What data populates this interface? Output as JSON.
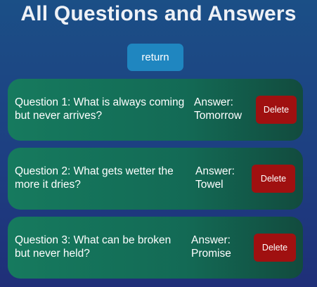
{
  "page": {
    "title": "All Questions and Answers",
    "return_label": "return"
  },
  "cards": [
    {
      "question_line1": "Question 1: What is always coming",
      "question_line2": "but never arrives?",
      "answer_label": "Answer:",
      "answer_value": "Tomorrow",
      "delete_label": "Delete"
    },
    {
      "question_line1": "Question 2: What gets wetter the",
      "question_line2": "more it dries?",
      "answer_label": "Answer:",
      "answer_value": "Towel",
      "delete_label": "Delete"
    },
    {
      "question_line1": "Question 3: What can be broken",
      "question_line2": "but never held?",
      "answer_label": "Answer:",
      "answer_value": "Promise",
      "delete_label": "Delete"
    }
  ],
  "colors": {
    "background_top": "#1b4f86",
    "background_bottom": "#1f2f78",
    "card_green": "#167a5e",
    "return_blue": "#1f86c0",
    "delete_red": "#a01010"
  }
}
